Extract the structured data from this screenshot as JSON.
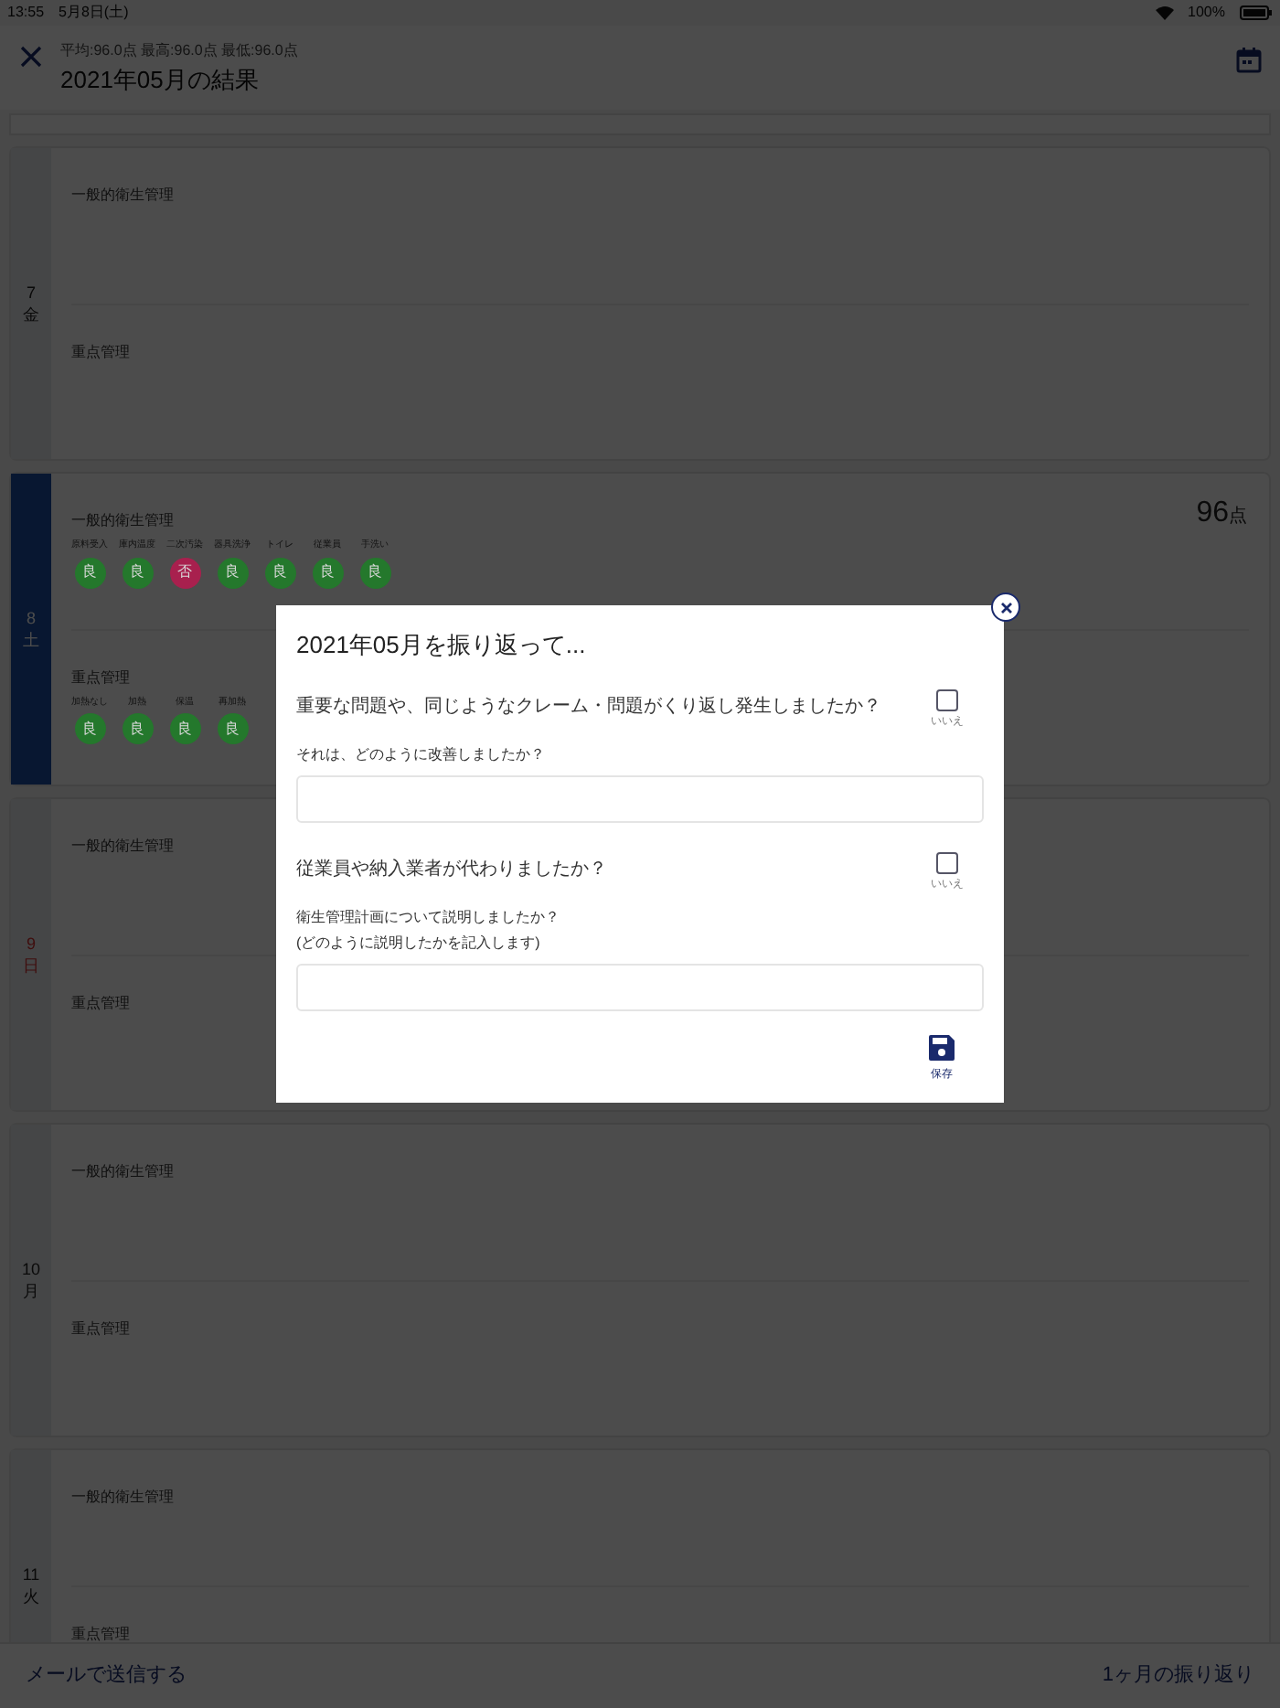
{
  "status_bar": {
    "time": "13:55",
    "date": "5月8日(土)",
    "battery": "100%"
  },
  "header": {
    "stats": "平均:96.0点 最高:96.0点 最低:96.0点",
    "title": "2021年05月の結果"
  },
  "days": [
    {
      "day": "7",
      "weekday": "金",
      "selected": false,
      "holiday": false,
      "sections": [
        {
          "title": "一般的衛生管理"
        },
        {
          "title": "重点管理"
        }
      ]
    },
    {
      "day": "8",
      "weekday": "土",
      "selected": true,
      "holiday": false,
      "score": "96",
      "score_unit": "点",
      "sections": [
        {
          "title": "一般的衛生管理",
          "items": [
            {
              "label": "原料受入",
              "result": "良",
              "kind": "good"
            },
            {
              "label": "庫内温度",
              "result": "良",
              "kind": "good"
            },
            {
              "label": "二次汚染",
              "result": "否",
              "kind": "bad"
            },
            {
              "label": "器具洗浄",
              "result": "良",
              "kind": "good"
            },
            {
              "label": "トイレ",
              "result": "良",
              "kind": "good"
            },
            {
              "label": "従業員",
              "result": "良",
              "kind": "good"
            },
            {
              "label": "手洗い",
              "result": "良",
              "kind": "good"
            }
          ]
        },
        {
          "title": "重点管理",
          "items": [
            {
              "label": "加熱なし",
              "result": "良",
              "kind": "good"
            },
            {
              "label": "加熱",
              "result": "良",
              "kind": "good"
            },
            {
              "label": "保温",
              "result": "良",
              "kind": "good"
            },
            {
              "label": "再加熱",
              "result": "良",
              "kind": "good"
            }
          ]
        }
      ]
    },
    {
      "day": "9",
      "weekday": "日",
      "selected": false,
      "holiday": true,
      "sections": [
        {
          "title": "一般的衛生管理"
        },
        {
          "title": "重点管理"
        }
      ]
    },
    {
      "day": "10",
      "weekday": "月",
      "selected": false,
      "holiday": false,
      "sections": [
        {
          "title": "一般的衛生管理"
        },
        {
          "title": "重点管理"
        }
      ]
    },
    {
      "day": "11",
      "weekday": "火",
      "selected": false,
      "holiday": false,
      "sections": [
        {
          "title": "一般的衛生管理"
        },
        {
          "title": "重点管理"
        }
      ]
    }
  ],
  "footer": {
    "left": "メールで送信する",
    "right": "1ヶ月の振り返り"
  },
  "dialog": {
    "title": "2021年05月を振り返って...",
    "questions": [
      {
        "question": "重要な問題や、同じようなクレーム・問題がくり返し発生しましたか？",
        "checked": false,
        "check_label": "いいえ",
        "prompt": [
          "それは、どのように改善しましたか？"
        ]
      },
      {
        "question": "従業員や納入業者が代わりましたか？",
        "checked": false,
        "check_label": "いいえ",
        "prompt": [
          "衛生管理計画について説明しましたか？",
          "(どのように説明したかを記入します)"
        ]
      }
    ],
    "save": "保存"
  }
}
